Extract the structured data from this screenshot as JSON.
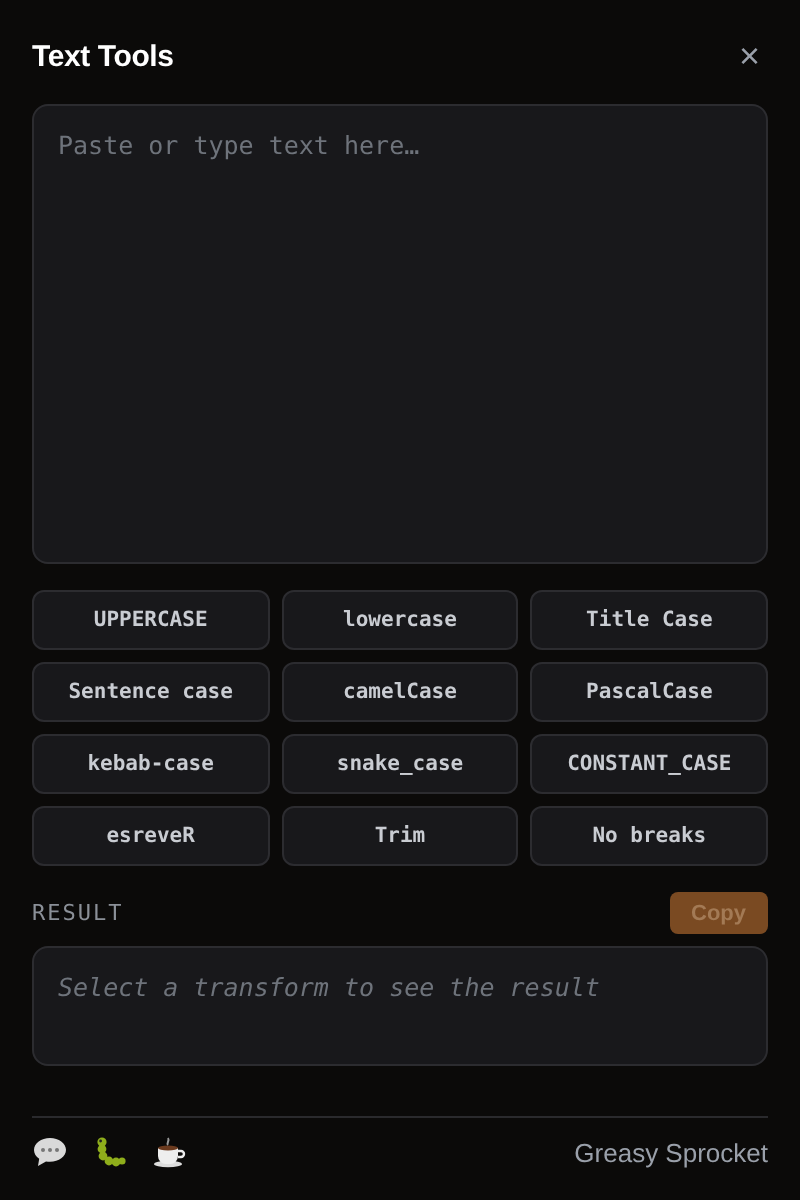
{
  "window": {
    "title": "Text Tools",
    "close": "×"
  },
  "input": {
    "placeholder": "Paste or type text here…"
  },
  "transforms": [
    {
      "label": "UPPERCASE"
    },
    {
      "label": "lowercase"
    },
    {
      "label": "Title Case"
    },
    {
      "label": "Sentence case"
    },
    {
      "label": "camelCase"
    },
    {
      "label": "PascalCase"
    },
    {
      "label": "kebab-case"
    },
    {
      "label": "snake_case"
    },
    {
      "label": "CONSTANT_CASE"
    },
    {
      "label": "esreveR"
    },
    {
      "label": "Trim"
    },
    {
      "label": "No breaks"
    }
  ],
  "result": {
    "label": "RESULT",
    "copy": {
      "label": "Copy",
      "disabled": true
    },
    "placeholder": "Select a transform to see the result"
  },
  "footer": {
    "icons": [
      {
        "kind": "chat"
      },
      {
        "kind": "bug"
      },
      {
        "kind": "coffee"
      }
    ],
    "author": "Greasy Sprocket"
  }
}
